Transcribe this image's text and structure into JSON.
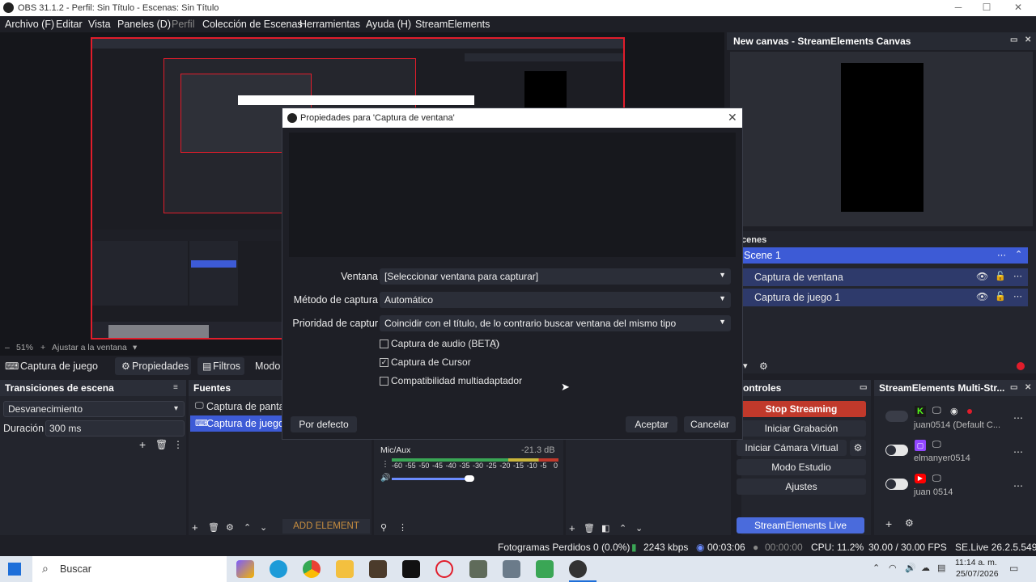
{
  "window": {
    "title": "OBS 31.1.2 - Perfil: Sin Título - Escenas: Sin Título"
  },
  "menu": [
    "Archivo (F)",
    "Editar",
    "Vista",
    "Paneles (D)",
    "Perfil",
    "Colección de Escenas",
    "Herramientas",
    "Ayuda (H)",
    "StreamElements"
  ],
  "canvas_dock": {
    "title": "New canvas - StreamElements Canvas"
  },
  "preview_bar": {
    "zoom": "51%",
    "fit": "Ajustar a la ventana"
  },
  "source_toolbar": {
    "source": "Captura de juego",
    "properties": "Propiedades",
    "filters": "Filtros",
    "mode": "Modo"
  },
  "transitions": {
    "title": "Transiciones de escena",
    "selected": "Desvanecimiento",
    "duration_label": "Duración",
    "duration_value": "300 ms"
  },
  "sources": {
    "title": "Fuentes",
    "items": [
      "Captura de pantall",
      "Captura de juego"
    ],
    "add_element": "ADD ELEMENT"
  },
  "dialog": {
    "title": "Propiedades para 'Captura de ventana'",
    "window_label": "Ventana",
    "window_value": "[Seleccionar ventana para capturar]",
    "method_label": "Método de captura",
    "method_value": "Automático",
    "priority_label": "Prioridad de captur",
    "priority_value": "Coincidir con el título, de lo contrario buscar ventana del mismo tipo",
    "audio_label": "Captura de audio (BETA)",
    "cursor_label": "Captura de Cursor",
    "compat_label": "Compatibilidad multiadaptador",
    "audio_checked": false,
    "cursor_checked": true,
    "compat_checked": false,
    "defaults_button": "Por defecto",
    "accept_button": "Aceptar",
    "cancel_button": "Cancelar"
  },
  "scenes": {
    "title": "cenes",
    "scene": "Scene 1",
    "items": [
      "Captura de ventana",
      "Captura de juego 1"
    ]
  },
  "mixer": {
    "channel": "Mic/Aux",
    "level": "-21.3 dB",
    "ticks": [
      "-60",
      "-55",
      "-50",
      "-45",
      "-40",
      "-35",
      "-30",
      "-25",
      "-20",
      "-15",
      "-10",
      "-5",
      "0"
    ]
  },
  "controls": {
    "title": "ontroles",
    "stop_streaming": "Stop Streaming",
    "start_recording": "Iniciar Grabación",
    "virtual_cam": "Iniciar Cámara Virtual",
    "studio_mode": "Modo Estudio",
    "settings": "Ajustes",
    "live_support": "StreamElements Live Support"
  },
  "multistream": {
    "title": "StreamElements Multi-Str...",
    "accounts": [
      "juan0514 (Default C...",
      "elmanyer0514",
      "juan 0514"
    ]
  },
  "status": {
    "dropped_frames": "Fotogramas Perdidos 0 (0.0%)",
    "bitrate": "2243 kbps",
    "stream_time": "00:03:06",
    "rec_time": "00:00:00",
    "cpu": "CPU: 11.2%",
    "fps": "30.00 / 30.00 FPS",
    "version": "SE.Live 26.2.5.549"
  },
  "taskbar": {
    "search": "Buscar",
    "time": "11:14 a. m.",
    "date": "25/07/2026"
  },
  "colors": {
    "accent": "#3d5bd6",
    "record": "#e11d2b",
    "live_support": "#4a6bdc"
  }
}
